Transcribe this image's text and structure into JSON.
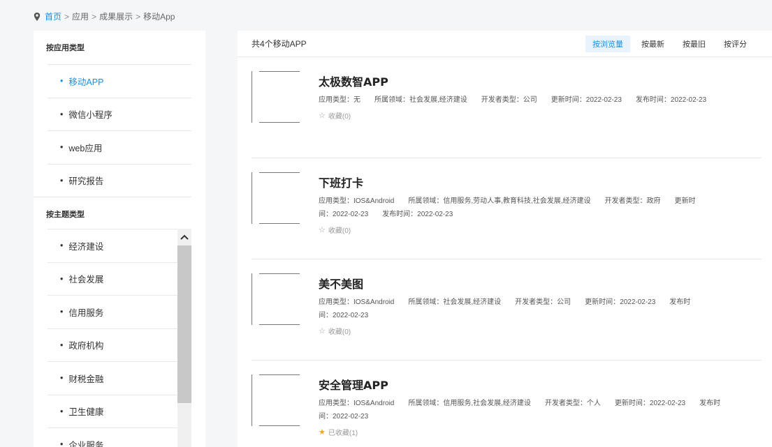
{
  "breadcrumb": {
    "home": "首页",
    "sep": ">",
    "crumbs": [
      "应用",
      "成果展示",
      "移动App"
    ]
  },
  "sidebar": {
    "app_type_heading": "按应用类型",
    "app_types": [
      "移动APP",
      "微信小程序",
      "web应用",
      "研究报告"
    ],
    "theme_heading": "按主题类型",
    "themes": [
      "经济建设",
      "社会发展",
      "信用服务",
      "政府机构",
      "财税金融",
      "卫生健康",
      "企业服务"
    ],
    "bullet": "•"
  },
  "toolbar": {
    "count_text": "共4个移动APP",
    "sorts": [
      "按浏览量",
      "按最新",
      "按最旧",
      "按评分"
    ]
  },
  "items": [
    {
      "title": "太极数智APP",
      "meta_line1": "应用类型：无　　所属领域：社会发展,经济建设　　开发者类型：公司　　更新时间：2022-02-23　　发布时间：2022-02-23",
      "meta_line2": "",
      "fav": "收藏(0)"
    },
    {
      "title": "下班打卡",
      "meta_line1": "应用类型：IOS&Android　　所属领域：信用服务,劳动人事,教育科技,社会发展,经济建设　　开发者类型：政府　　更新时",
      "meta_line2": "间：2022-02-23　　发布时间：2022-02-23",
      "fav": "收藏(0)"
    },
    {
      "title": "美不美图",
      "meta_line1": "应用类型：IOS&Android　　所属领域：社会发展,经济建设　　开发者类型：公司　　更新时间：2022-02-23　　发布时",
      "meta_line2": "间：2022-02-23",
      "fav": "收藏(0)"
    },
    {
      "title": "安全管理APP",
      "meta_line1": "应用类型：IOS&Android　　所属领域：信用服务,社会发展,经济建设　　开发者类型：个人　　更新时间：2022-02-23　　发布时",
      "meta_line2": "间：2022-02-23",
      "fav": "已收藏(1)"
    }
  ],
  "colors": {
    "accent": "#1a8fe3",
    "star_active": "#f2a623"
  },
  "icons": {
    "breadcrumb": "location-pin-icon",
    "fav": "star-icon",
    "scroll": "chevron-up-icon"
  }
}
